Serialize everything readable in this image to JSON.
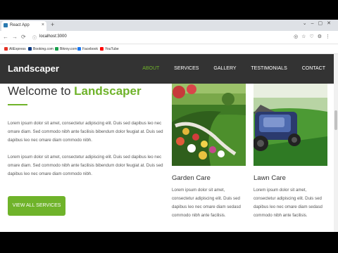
{
  "browser": {
    "tab_title": "React App",
    "url": "localhost:3000",
    "bookmarks": [
      "AliExpress",
      "Booking.com",
      "Bikroy.com",
      "Facebook",
      "YouTube"
    ]
  },
  "nav": {
    "brand": "Landscaper",
    "items": [
      "ABOUT",
      "SERVICES",
      "GALLERY",
      "TESTIMONIALS",
      "CONTACT"
    ],
    "active": "ABOUT"
  },
  "hero": {
    "heading_prefix": "Welcome to ",
    "heading_highlight": "Landscaper",
    "paragraph1": "Lorem ipsum dolor sit amet, consectetur adipiscing elit. Duis sed dapibus leo nec omare diam. Sed commodo nibh ante facilisis bibendum dolor feugiat at. Duis sed dapibus leo nec omare diam commodo nibh.",
    "paragraph2": "Lorem ipsum dolor sit amet, consectetur adipiscing elit. Duis sed dapibus leo nec omare diam. Sed commodo nibh ante facilisis bibendum dolor feugiat at. Duis sed dapibus leo nec omare diam commodo nibh.",
    "button": "VIEW ALL SERVICES"
  },
  "cards": [
    {
      "title": "Garden Care",
      "text": "Lorem ipsum dolor sit amet, consectetur adipiscing elit. Duis sed dapibus leo nec omare diam sedasd commodo nibh ante facilisis."
    },
    {
      "title": "Lawn Care",
      "text": "Lorem ipsum dolor sit amet, consectetur adipiscing elit. Duis sed dapibus leo nec omare diam sedasd commodo nibh ante facilisis."
    }
  ],
  "colors": {
    "accent": "#6fb32a",
    "nav_bg": "#333333"
  }
}
